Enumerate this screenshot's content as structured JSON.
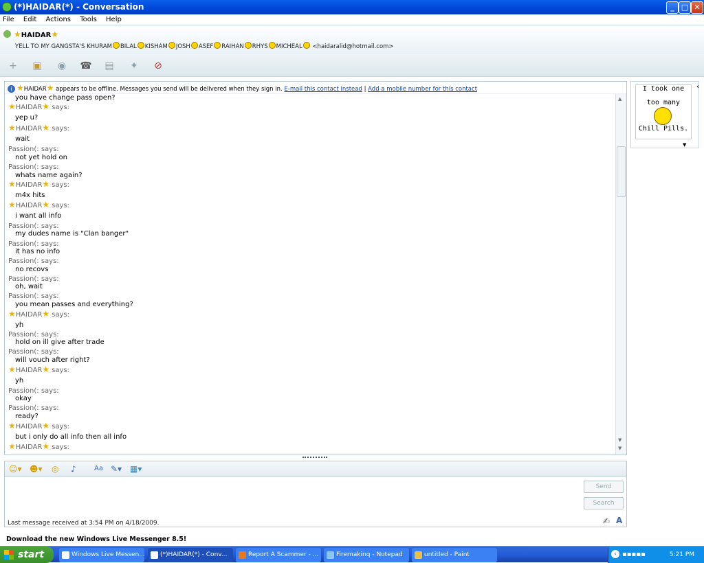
{
  "window": {
    "title": "(*)HAIDAR(*) - Conversation",
    "buttons": {
      "minimize": "_",
      "maximize": "□",
      "close": "✕"
    }
  },
  "menu": [
    "File",
    "Edit",
    "Actions",
    "Tools",
    "Help"
  ],
  "contact": {
    "name": "HAIDAR",
    "psm_parts": [
      "YELL TO MY GANGSTA'S KHURAM",
      "BILAL",
      "KISHAM",
      "JOSH",
      "ASEF",
      "RAIHAN",
      "RHYS",
      "MICHEAL"
    ],
    "email": "<haidaralid@hotmail.com>"
  },
  "toolbar_icons": [
    "add-contact-icon",
    "share-folders-icon",
    "video-call-icon",
    "call-icon",
    "activities-icon",
    "games-icon",
    "block-icon"
  ],
  "infobar": {
    "name": "HAIDAR",
    "text": "appears to be offline. Messages you send will be delivered when they sign in.",
    "link1": "E-mail this contact instead",
    "sep": "|",
    "link2": "Add a mobile number for this contact"
  },
  "messages": [
    {
      "type": "body",
      "text": "you have change pass open?"
    },
    {
      "type": "haidar",
      "says": "says:"
    },
    {
      "type": "body",
      "text": "yep u?"
    },
    {
      "type": "haidar",
      "says": "says:"
    },
    {
      "type": "body",
      "text": "wait"
    },
    {
      "type": "sender",
      "text": "Passion(: says:"
    },
    {
      "type": "body",
      "text": "not yet hold on"
    },
    {
      "type": "sender",
      "text": "Passion(: says:"
    },
    {
      "type": "body",
      "text": "whats name again?"
    },
    {
      "type": "haidar",
      "says": "says:"
    },
    {
      "type": "body",
      "text": "m4x hits"
    },
    {
      "type": "haidar",
      "says": "says:"
    },
    {
      "type": "body",
      "text": "i want all info"
    },
    {
      "type": "sender",
      "text": "Passion(: says:"
    },
    {
      "type": "body",
      "text": "my dudes name is \"Clan banger\""
    },
    {
      "type": "sender",
      "text": "Passion(: says:"
    },
    {
      "type": "body",
      "text": "it has no info"
    },
    {
      "type": "sender",
      "text": "Passion(: says:"
    },
    {
      "type": "body",
      "text": "no recovs"
    },
    {
      "type": "sender",
      "text": "Passion(: says:"
    },
    {
      "type": "body",
      "text": "oh, wait"
    },
    {
      "type": "sender",
      "text": "Passion(: says:"
    },
    {
      "type": "body",
      "text": "you mean passes and everything?"
    },
    {
      "type": "haidar",
      "says": "says:"
    },
    {
      "type": "body",
      "text": "yh"
    },
    {
      "type": "sender",
      "text": "Passion(: says:"
    },
    {
      "type": "body",
      "text": "hold on ill give after trade"
    },
    {
      "type": "sender",
      "text": "Passion(: says:"
    },
    {
      "type": "body",
      "text": "will vouch after right?"
    },
    {
      "type": "haidar",
      "says": "says:"
    },
    {
      "type": "body",
      "text": "yh"
    },
    {
      "type": "sender",
      "text": "Passion(: says:"
    },
    {
      "type": "body",
      "text": "okay"
    },
    {
      "type": "sender",
      "text": "Passion(: says:"
    },
    {
      "type": "body",
      "text": "ready?"
    },
    {
      "type": "haidar",
      "says": "says:"
    },
    {
      "type": "body",
      "text": "but i only do all info then all info"
    },
    {
      "type": "haidar",
      "says": "says:"
    }
  ],
  "haidar_name": "HAIDAR",
  "input": {
    "send_label": "Send",
    "search_label": "Search",
    "value": ""
  },
  "status": {
    "last_message": "Last message received at 3:54 PM on 4/18/2009."
  },
  "download_banner": "Download the new Windows Live Messenger 8.5!",
  "display_picture": {
    "line1": "I took one",
    "line2": "too many",
    "line3": "Chill Pills."
  },
  "taskbar": {
    "start_label": "start",
    "tasks": [
      {
        "label": "Windows Live Messen...",
        "active": false
      },
      {
        "label": "(*)HAIDAR(*) - Conv...",
        "active": true
      },
      {
        "label": "Report A Scammer - ...",
        "active": false
      },
      {
        "label": "Firemakinq - Notepad",
        "active": false
      },
      {
        "label": "untitled - Paint",
        "active": false
      }
    ],
    "clock": "5:21 PM"
  }
}
